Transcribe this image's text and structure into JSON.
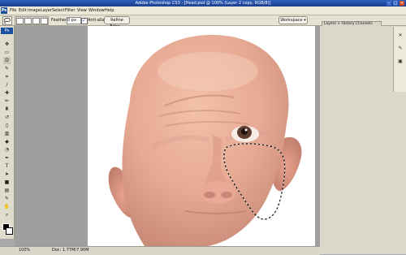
{
  "window": {
    "title": "Adobe Photoshop CS3 - [Head.psd @ 100% (Layer 2 copy, RGB/8)]",
    "controls": [
      "minimize-icon",
      "maximize-icon",
      "close-icon"
    ]
  },
  "app_logo": "Ps",
  "menu": [
    "File",
    "Edit",
    "Image",
    "Layer",
    "Select",
    "Filter",
    "View",
    "Window",
    "Help"
  ],
  "options": {
    "feather_label": "Feather:",
    "feather_value": "0 px",
    "antialias_label": "Anti-alias",
    "refine_edge": "Refine Edge...",
    "workspace": "Workspace ▾"
  },
  "panels": {
    "tabs": "Layers × History Channels Paths"
  },
  "status": {
    "zoom": "100%",
    "doc": "Doc: 1.77M/7.90M"
  },
  "colors": {
    "titlebar": "#1c3f8f",
    "chrome": "#ece9d8",
    "canvas_bg": "#9f9f9f"
  },
  "tools": [
    "move-tool-icon",
    "marquee-tool-icon",
    "lasso-tool-icon",
    "quick-selection-icon",
    "crop-tool-icon",
    "slice-tool-icon",
    "healing-brush-icon",
    "brush-tool-icon",
    "stamp-tool-icon",
    "history-brush-icon",
    "eraser-tool-icon",
    "gradient-tool-icon",
    "blur-tool-icon",
    "dodge-tool-icon",
    "pen-tool-icon",
    "type-tool-icon",
    "path-select-icon",
    "shape-tool-icon",
    "notes-tool-icon",
    "eyedropper-icon",
    "hand-tool-icon",
    "zoom-tool-icon"
  ]
}
